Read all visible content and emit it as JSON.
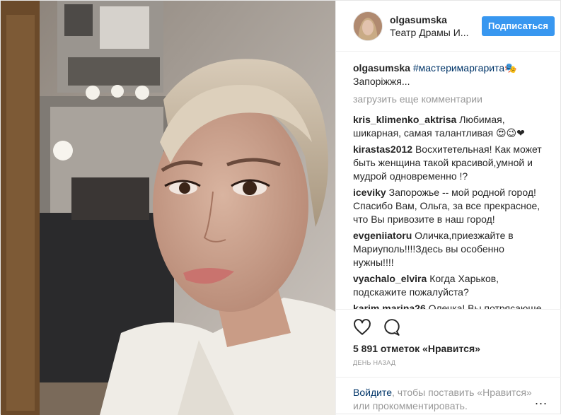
{
  "post": {
    "photo_alt": "",
    "header": {
      "username": "olgasumska",
      "location": "Театр Драмы И...",
      "follow_label": "Подписаться"
    },
    "caption": {
      "author": "olgasumska",
      "hashtag": "#мастеримаргарита🎭",
      "text": "Запоріжжя..."
    },
    "load_more": "загрузить еще комментарии",
    "comments": [
      {
        "author": "kris_klimenko_aktrisa",
        "text": "Любимая, шикарная, самая талантливая 😍😉❤"
      },
      {
        "author": "kirastas2012",
        "text": "Восхитетельная! Как может быть женщина такой красивой,умной и мудрой одновременно !?"
      },
      {
        "author": "iceviky",
        "text": "Запорожье -- мой родной город! Спасибо Вам, Ольга, за все прекрасное, что Вы привозите в наш город!"
      },
      {
        "author": "evgeniiatoru",
        "text": "Оличка,приезжайте в Мариуполь!!!!Здесь вы особенно нужны!!!!"
      },
      {
        "author": "vyachalo_elvira",
        "text": "Когда Харьков, подскажите пожалуйста?"
      },
      {
        "author": "karim.marina26",
        "text": "Олечка! Вы потрясающе"
      }
    ],
    "icons": {
      "like": "heart-icon",
      "comment": "comment-bubble-icon",
      "more": "more-options-icon"
    },
    "likes_text": "5 891 отметок «Нравится»",
    "time_text": "ДЕНЬ НАЗАД",
    "login_link": "Войдите",
    "login_text": ", чтобы поставить «Нравится» или прокомментировать.",
    "more_label": "...",
    "colors": {
      "accent": "#3897f0",
      "link": "#003569",
      "muted": "#999999"
    }
  }
}
